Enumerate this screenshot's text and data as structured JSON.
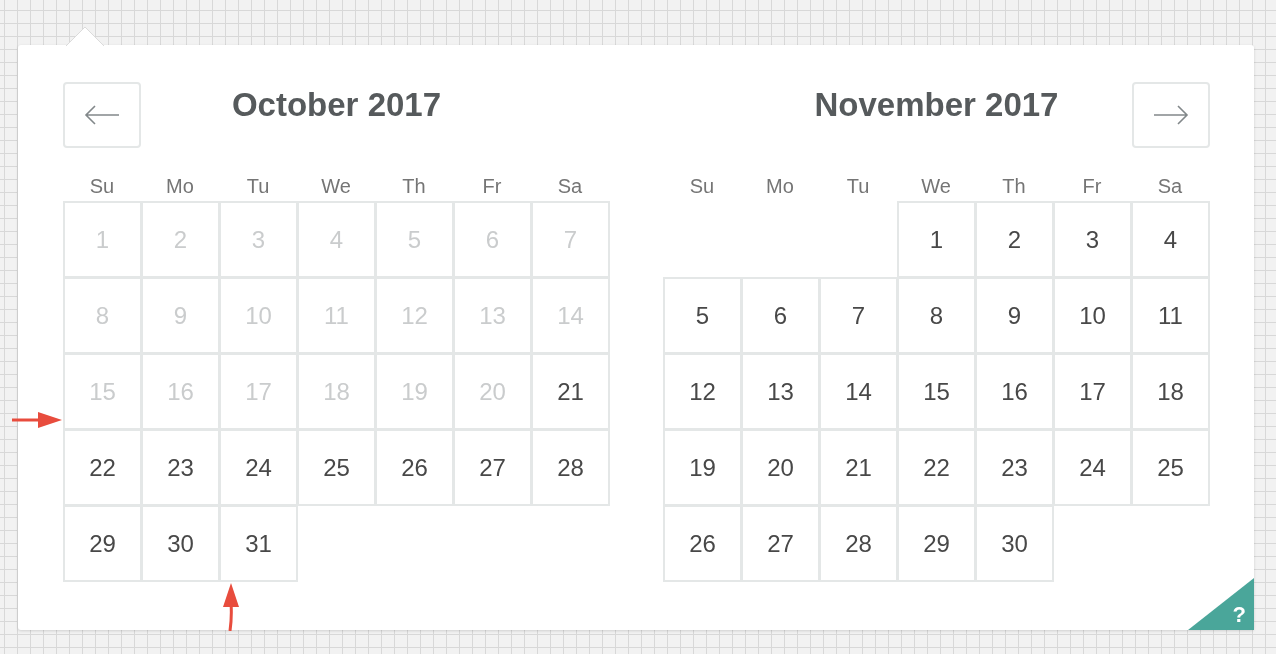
{
  "months": [
    {
      "title": "October 2017",
      "nav": {
        "kind": "prev"
      },
      "weekdays": [
        "Su",
        "Mo",
        "Tu",
        "We",
        "Th",
        "Fr",
        "Sa"
      ],
      "weeks": [
        [
          {
            "kind": "day",
            "label": "1",
            "disabled": true
          },
          {
            "kind": "day",
            "label": "2",
            "disabled": true
          },
          {
            "kind": "day",
            "label": "3",
            "disabled": true
          },
          {
            "kind": "day",
            "label": "4",
            "disabled": true
          },
          {
            "kind": "day",
            "label": "5",
            "disabled": true
          },
          {
            "kind": "day",
            "label": "6",
            "disabled": true
          },
          {
            "kind": "day",
            "label": "7",
            "disabled": true
          }
        ],
        [
          {
            "kind": "day",
            "label": "8",
            "disabled": true
          },
          {
            "kind": "day",
            "label": "9",
            "disabled": true
          },
          {
            "kind": "day",
            "label": "10",
            "disabled": true
          },
          {
            "kind": "day",
            "label": "11",
            "disabled": true
          },
          {
            "kind": "day",
            "label": "12",
            "disabled": true
          },
          {
            "kind": "day",
            "label": "13",
            "disabled": true
          },
          {
            "kind": "day",
            "label": "14",
            "disabled": true
          }
        ],
        [
          {
            "kind": "day",
            "label": "15",
            "disabled": true
          },
          {
            "kind": "day",
            "label": "16",
            "disabled": true
          },
          {
            "kind": "day",
            "label": "17",
            "disabled": true
          },
          {
            "kind": "day",
            "label": "18",
            "disabled": true
          },
          {
            "kind": "day",
            "label": "19",
            "disabled": true
          },
          {
            "kind": "day",
            "label": "20",
            "disabled": true
          },
          {
            "kind": "day",
            "label": "21",
            "disabled": false
          }
        ],
        [
          {
            "kind": "day",
            "label": "22",
            "disabled": false
          },
          {
            "kind": "day",
            "label": "23",
            "disabled": false
          },
          {
            "kind": "day",
            "label": "24",
            "disabled": false
          },
          {
            "kind": "day",
            "label": "25",
            "disabled": false
          },
          {
            "kind": "day",
            "label": "26",
            "disabled": false
          },
          {
            "kind": "day",
            "label": "27",
            "disabled": false
          },
          {
            "kind": "day",
            "label": "28",
            "disabled": false
          }
        ],
        [
          {
            "kind": "day",
            "label": "29",
            "disabled": false
          },
          {
            "kind": "day",
            "label": "30",
            "disabled": false
          },
          {
            "kind": "day",
            "label": "31",
            "disabled": false
          }
        ]
      ]
    },
    {
      "title": "November 2017",
      "nav": {
        "kind": "next"
      },
      "weekdays": [
        "Su",
        "Mo",
        "Tu",
        "We",
        "Th",
        "Fr",
        "Sa"
      ],
      "weeks": [
        [
          {
            "kind": "blank"
          },
          {
            "kind": "blank"
          },
          {
            "kind": "blank"
          },
          {
            "kind": "day",
            "label": "1",
            "disabled": false
          },
          {
            "kind": "day",
            "label": "2",
            "disabled": false
          },
          {
            "kind": "day",
            "label": "3",
            "disabled": false
          },
          {
            "kind": "day",
            "label": "4",
            "disabled": false
          }
        ],
        [
          {
            "kind": "day",
            "label": "5",
            "disabled": false
          },
          {
            "kind": "day",
            "label": "6",
            "disabled": false
          },
          {
            "kind": "day",
            "label": "7",
            "disabled": false
          },
          {
            "kind": "day",
            "label": "8",
            "disabled": false
          },
          {
            "kind": "day",
            "label": "9",
            "disabled": false
          },
          {
            "kind": "day",
            "label": "10",
            "disabled": false
          },
          {
            "kind": "day",
            "label": "11",
            "disabled": false
          }
        ],
        [
          {
            "kind": "day",
            "label": "12",
            "disabled": false
          },
          {
            "kind": "day",
            "label": "13",
            "disabled": false
          },
          {
            "kind": "day",
            "label": "14",
            "disabled": false
          },
          {
            "kind": "day",
            "label": "15",
            "disabled": false
          },
          {
            "kind": "day",
            "label": "16",
            "disabled": false
          },
          {
            "kind": "day",
            "label": "17",
            "disabled": false
          },
          {
            "kind": "day",
            "label": "18",
            "disabled": false
          }
        ],
        [
          {
            "kind": "day",
            "label": "19",
            "disabled": false
          },
          {
            "kind": "day",
            "label": "20",
            "disabled": false
          },
          {
            "kind": "day",
            "label": "21",
            "disabled": false
          },
          {
            "kind": "day",
            "label": "22",
            "disabled": false
          },
          {
            "kind": "day",
            "label": "23",
            "disabled": false
          },
          {
            "kind": "day",
            "label": "24",
            "disabled": false
          },
          {
            "kind": "day",
            "label": "25",
            "disabled": false
          }
        ],
        [
          {
            "kind": "day",
            "label": "26",
            "disabled": false
          },
          {
            "kind": "day",
            "label": "27",
            "disabled": false
          },
          {
            "kind": "day",
            "label": "28",
            "disabled": false
          },
          {
            "kind": "day",
            "label": "29",
            "disabled": false
          },
          {
            "kind": "day",
            "label": "30",
            "disabled": false
          }
        ]
      ]
    }
  ],
  "help": {
    "label": "?"
  }
}
